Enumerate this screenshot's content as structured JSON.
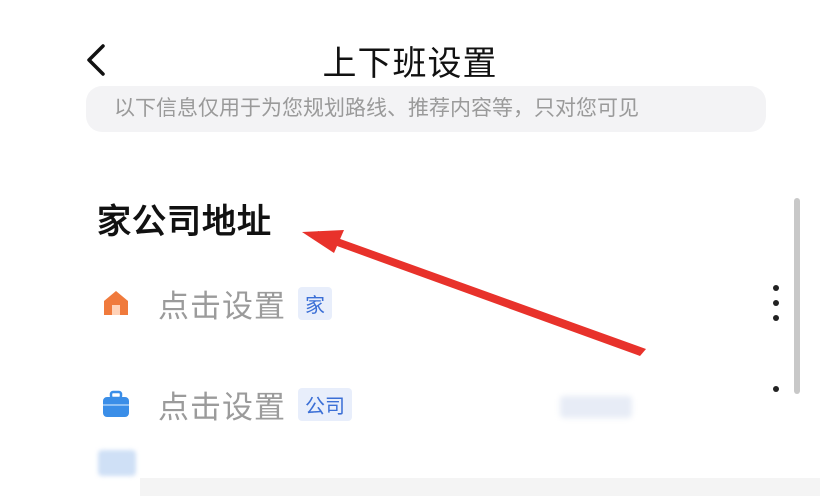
{
  "header": {
    "back_icon": "chevron-left-icon",
    "title": "上下班设置"
  },
  "notice": {
    "text": "以下信息仅用于为您规划路线、推荐内容等，只对您可见"
  },
  "section": {
    "title": "家公司地址"
  },
  "addresses": [
    {
      "label": "点击设置",
      "tag": "家",
      "icon": "home-icon",
      "icon_color": "#f07a3c"
    },
    {
      "label": "点击设置",
      "tag": "公司",
      "icon": "briefcase-icon",
      "icon_color": "#3a8ee8"
    }
  ],
  "annotation": {
    "arrow_color": "#e8322b"
  },
  "colors": {
    "tag_bg": "#e8eefb",
    "tag_text": "#3b6fd6",
    "label_gray": "#9b9b9b"
  }
}
